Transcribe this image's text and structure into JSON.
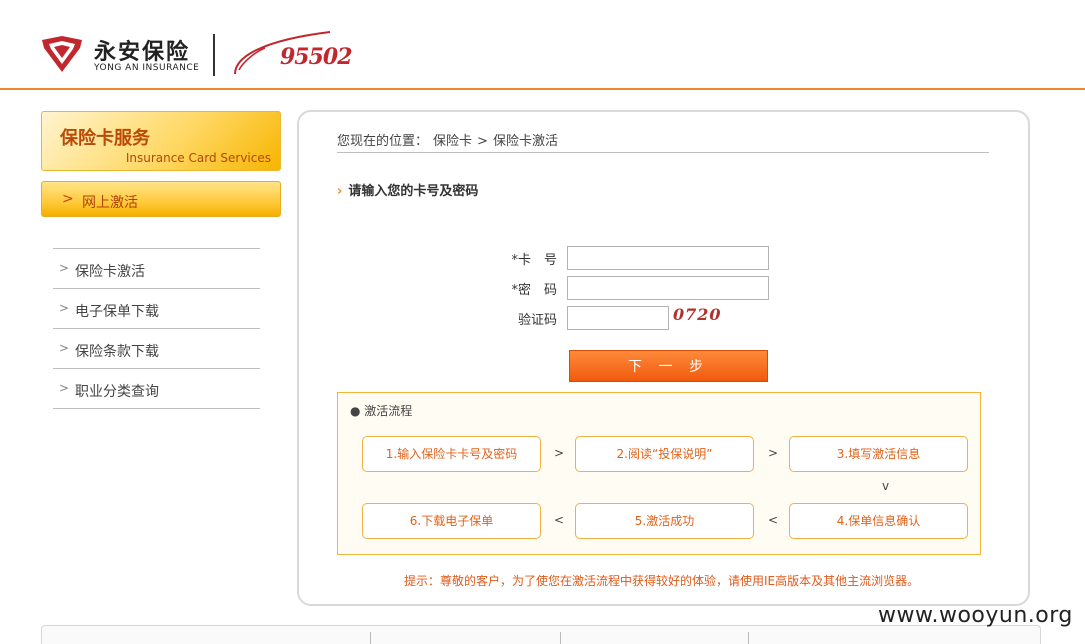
{
  "header": {
    "brand_cn": "永安保险",
    "brand_en": "YONG AN INSURANCE",
    "hotline": "95502",
    "colors": {
      "brand_red": "#c1272d",
      "accent_orange": "#e9892a"
    }
  },
  "sidebar": {
    "title_cn": "保险卡服务",
    "title_en": "Insurance Card Services",
    "active_item": "网上激活",
    "items": [
      {
        "label": "保险卡激活"
      },
      {
        "label": "电子保单下载"
      },
      {
        "label": "保险条款下载"
      },
      {
        "label": "职业分类查询"
      }
    ]
  },
  "main": {
    "breadcrumb": {
      "prefix": "您现在的位置：",
      "level1": "保险卡",
      "sep": ">",
      "level2": "保险卡激活"
    },
    "section_title": "请输入您的卡号及密码",
    "form": {
      "card_label": "*卡　号",
      "card_value": "",
      "password_label": "*密　码",
      "password_value": "",
      "captcha_label": "验证码",
      "captcha_value": "",
      "captcha_text": "0720",
      "next_button": "下 一 步"
    },
    "flow": {
      "title": "● 激活流程",
      "steps": [
        "1.输入保险卡卡号及密码",
        "2.阅读“投保说明”",
        "3.填写激活信息",
        "4.保单信息确认",
        "5.激活成功",
        "6.下载电子保单"
      ],
      "arrow_right": ">",
      "arrow_left": "<",
      "arrow_down": "v"
    },
    "tip": "提示：尊敬的客户，为了使您在激活流程中获得较好的体验，请使用IE高版本及其他主流浏览器。"
  },
  "watermark": "www.wooyun.org"
}
